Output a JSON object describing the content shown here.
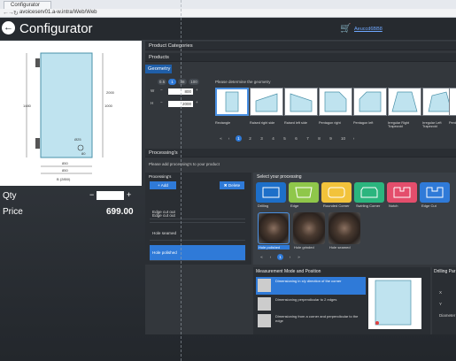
{
  "browser": {
    "tab_title": "Configurator",
    "url": "avoiceserv01.a-w.intra/Web/Web"
  },
  "header": {
    "title": "Configurator",
    "cart_link": "Aeuccd6BB8"
  },
  "left": {
    "qty_label": "Qty",
    "qty_value": "",
    "price_label": "Price",
    "price_value": "699.00"
  },
  "drawing": {
    "dims": [
      "1480",
      "1000",
      "Ø25",
      "850",
      "80",
      "2000",
      "850",
      "B (2850)"
    ]
  },
  "sections": {
    "categories": "Product Categories",
    "products": "Products",
    "geometry": "Geometry",
    "processings": "Processing's"
  },
  "geometry": {
    "zoom_options": [
      "0.5",
      "1",
      "38",
      "100"
    ],
    "zoom_selected": 1,
    "w_label": "W",
    "h_label": "H",
    "w_value": "800",
    "h_value": "2000",
    "instruction": "Please determine the geometry",
    "shapes": [
      "Rectangle",
      "Raised right side",
      "Raised left side",
      "Pentagon right",
      "Pentagon left",
      "Irregular Right Trapezoid",
      "Irregular Left Trapezoid",
      "Pentago"
    ],
    "pages": [
      "«",
      "‹",
      "1",
      "2",
      "3",
      "4",
      "5",
      "6",
      "7",
      "8",
      "9",
      "10",
      "›"
    ],
    "page_active": 2
  },
  "processings": {
    "instruction": "Please add processing's to your product",
    "list_title": "Processing's",
    "add_btn": "Add",
    "delete_btn": "Delete",
    "items": [
      "Edge cut out",
      "Edge cut out",
      "Hole seamed",
      "Hole polished"
    ],
    "selected": 3,
    "select_title": "Select your processing",
    "types": [
      {
        "label": "Drilling",
        "color": "#1d6fc9"
      },
      {
        "label": "Edge",
        "color": "#8fc74a"
      },
      {
        "label": "Rounded Corner",
        "color": "#f2c33b"
      },
      {
        "label": "Swirling Corner",
        "color": "#2bb57e"
      },
      {
        "label": "Notch",
        "color": "#e44e6c"
      },
      {
        "label": "Edge Cut",
        "color": "#2f7ad8"
      }
    ],
    "holes": [
      "Hole polished",
      "Hole grinded",
      "Hole seamed"
    ],
    "holes_pages": [
      "«",
      "‹",
      "1",
      "›",
      "»"
    ]
  },
  "measurement": {
    "title": "Measurement Mode and Position",
    "options": [
      "Dimensioning in x/y direction of the corner",
      "Dimensioning perpendicular to 2 edges",
      "Dimensioning from a corner and perpendicular to the edge"
    ],
    "selected": 0,
    "drilling_title": "Drilling Par",
    "fields": [
      "X",
      "Y",
      "Diameter"
    ]
  }
}
